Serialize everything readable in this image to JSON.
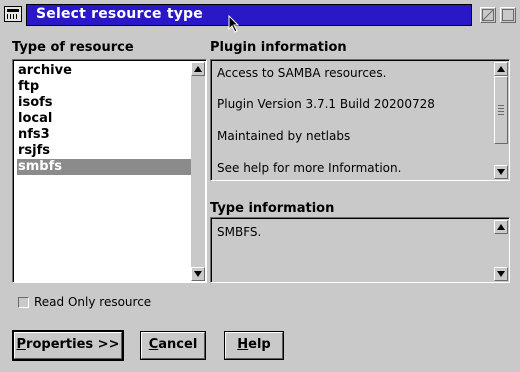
{
  "window": {
    "title": "Select resource type"
  },
  "resource_list": {
    "heading": "Type of resource",
    "items": [
      "archive",
      "ftp",
      "isofs",
      "local",
      "nfs3",
      "rsjfs",
      "smbfs"
    ],
    "selected": "smbfs"
  },
  "plugin_info": {
    "heading": "Plugin information",
    "lines": [
      "Access to SAMBA resources.",
      "Plugin Version 3.7.1 Build 20200728",
      "Maintained by netlabs",
      "See help for more Information."
    ]
  },
  "type_info": {
    "heading": "Type information",
    "text": "SMBFS."
  },
  "options": {
    "read_only_label": "Read Only resource",
    "read_only_checked": false
  },
  "buttons": {
    "properties": {
      "mnemonic": "P",
      "rest": "roperties >>"
    },
    "cancel": {
      "mnemonic": "C",
      "rest": "ancel"
    },
    "help": {
      "mnemonic": "H",
      "rest": "elp"
    }
  },
  "icons": {
    "system_menu": "window-system-menu-icon",
    "minimize": "minimize-icon",
    "maximize": "maximize-icon",
    "scroll_up": "arrow-up-icon",
    "scroll_down": "arrow-down-icon",
    "pointer": "mouse-pointer-icon"
  },
  "colors": {
    "titlebar_active": "#2a18c8",
    "selection": "#8b8b8b",
    "dialog_bg": "#c9c9c9"
  }
}
